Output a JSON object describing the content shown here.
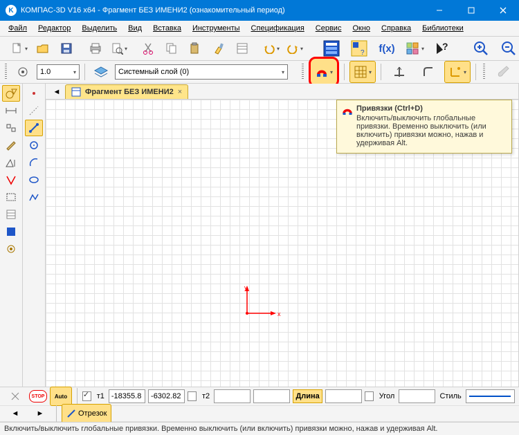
{
  "title": "КОМПАС-3D V16  x64 - Фрагмент БЕЗ ИМЕНИ2 (ознакомительный период)",
  "menu": [
    "Файл",
    "Редактор",
    "Выделить",
    "Вид",
    "Вставка",
    "Инструменты",
    "Спецификация",
    "Сервис",
    "Окно",
    "Справка",
    "Библиотеки"
  ],
  "line_scale": "1.0",
  "layer": "Системный слой (0)",
  "tab": {
    "label": "Фрагмент БЕЗ ИМЕНИ2",
    "close": "×"
  },
  "tooltip": {
    "title": "Привязки (Ctrl+D)",
    "body": "Включить/выключить глобальные привязки. Временно выключить (или включить) привязки можно, нажав и удерживая Alt."
  },
  "origin": {
    "x": "x",
    "y": "y"
  },
  "bottom": {
    "t1": "т1",
    "t1x": "-18355.8",
    "t1y": "-6302.82",
    "t2": "т2",
    "len_lbl": "Длина",
    "angle_lbl": "Угол",
    "style_lbl": "Стиль",
    "segment": "Отрезок",
    "stop": "STOP",
    "auto": "Auto"
  },
  "status": "Включить/выключить глобальные привязки. Временно выключить (или включить) привязки можно, нажав и удерживая Alt."
}
